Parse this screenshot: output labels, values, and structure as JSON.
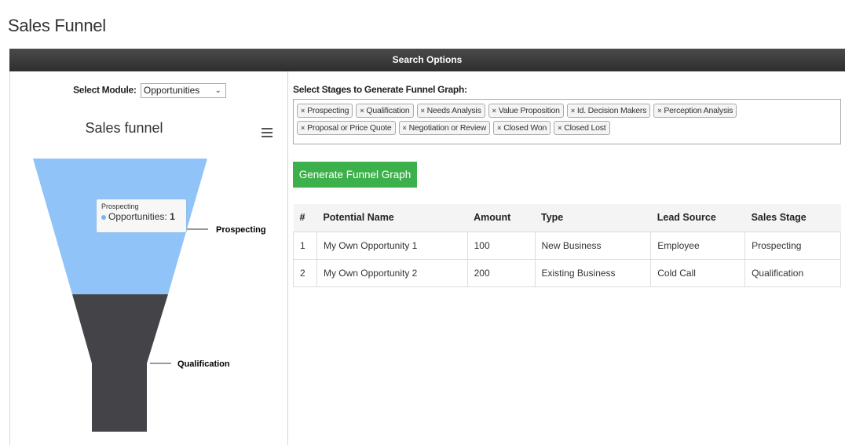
{
  "page": {
    "title": "Sales Funnel"
  },
  "search": {
    "title": "Search Options"
  },
  "module": {
    "label": "Select Module:",
    "selected": "Opportunities"
  },
  "chart": {
    "title": "Sales funnel",
    "menu_icon": "hamburger-menu-icon",
    "tooltip": {
      "header": "Prospecting",
      "series": "Opportunities:",
      "value": "1"
    },
    "colors": {
      "prospecting": "#90c4f9",
      "qualification": "#434348",
      "tooltip_dot": "#7cb5ec"
    }
  },
  "chart_data": {
    "type": "funnel",
    "title": "Sales funnel",
    "categories": [
      "Prospecting",
      "Qualification"
    ],
    "series": [
      {
        "name": "Opportunities",
        "values": [
          1,
          1
        ]
      }
    ]
  },
  "stages": {
    "label": "Select Stages to Generate Funnel Graph:",
    "tags": [
      "Prospecting",
      "Qualification",
      "Needs Analysis",
      "Value Proposition",
      "Id. Decision Makers",
      "Perception Analysis",
      "Proposal or Price Quote",
      "Negotiation or Review",
      "Closed Won",
      "Closed Lost"
    ]
  },
  "generate": {
    "label": "Generate Funnel Graph"
  },
  "table": {
    "headers": [
      "#",
      "Potential Name",
      "Amount",
      "Type",
      "Lead Source",
      "Sales Stage"
    ],
    "rows": [
      [
        "1",
        "My Own Opportunity 1",
        "100",
        "New Business",
        "Employee",
        "Prospecting"
      ],
      [
        "2",
        "My Own Opportunity 2",
        "200",
        "Existing Business",
        "Cold Call",
        "Qualification"
      ]
    ]
  }
}
